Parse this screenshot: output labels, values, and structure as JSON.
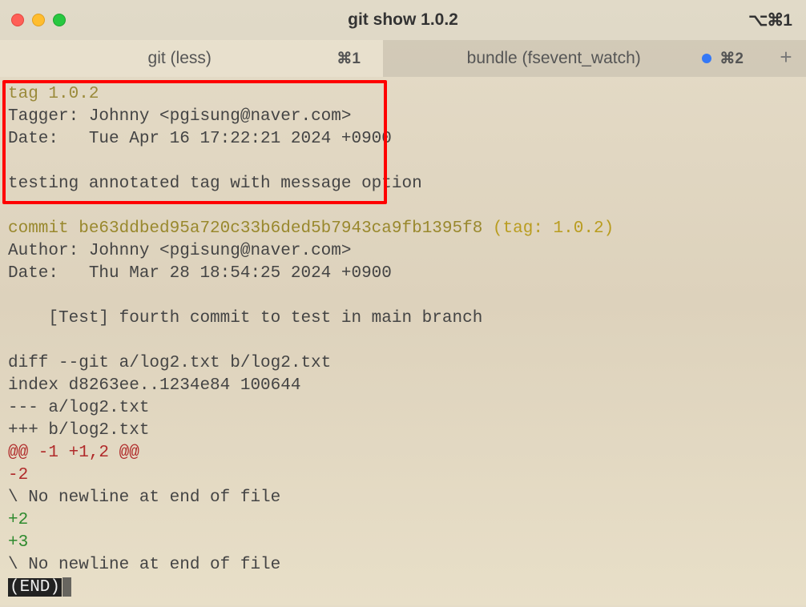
{
  "window": {
    "title": "git show 1.0.2",
    "shortcut": "⌥⌘1"
  },
  "tabs": [
    {
      "label": "git (less)",
      "shortcut": "⌘1",
      "active": true
    },
    {
      "label": "bundle (fsevent_watch)",
      "shortcut": "⌘2",
      "active": false,
      "indicator": true
    }
  ],
  "newtab_label": "+",
  "terminal": {
    "tag_line": "tag 1.0.2",
    "tagger_label": "Tagger:",
    "tagger_value": " Johnny <pgisung@naver.com>",
    "tag_date_label": "Date:",
    "tag_date_value": "   Tue Apr 16 17:22:21 2024 +0900",
    "tag_message": "testing annotated tag with message option",
    "commit_prefix": "commit ",
    "commit_hash": "be63ddbed95a720c33b6ded5b7943ca9fb1395f8",
    "tag_ref_open": " (",
    "tag_ref_label": "tag: 1.0.2",
    "tag_ref_close": ")",
    "author_label": "Author:",
    "author_value": " Johnny <pgisung@naver.com>",
    "commit_date_label": "Date:",
    "commit_date_value": "   Thu Mar 28 18:54:25 2024 +0900",
    "commit_message": "    [Test] fourth commit to test in main branch",
    "diff_header": "diff --git a/log2.txt b/log2.txt",
    "diff_index": "index d8263ee..1234e84 100644",
    "diff_minus_file": "--- a/log2.txt",
    "diff_plus_file": "+++ b/log2.txt",
    "hunk_header": "@@ -1 +1,2 @@",
    "line_removed": "-2",
    "no_newline_1": "\\ No newline at end of file",
    "line_added_1": "+2",
    "line_added_2": "+3",
    "no_newline_2": "\\ No newline at end of file",
    "end_marker": "(END)"
  }
}
